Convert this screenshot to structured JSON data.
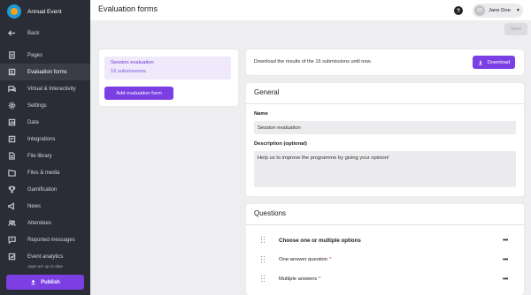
{
  "app": {
    "event_name": "Annual Event"
  },
  "sidebar": {
    "back": "Back",
    "items": [
      {
        "label": "Pages",
        "icon": "pages-icon"
      },
      {
        "label": "Evaluation forms",
        "icon": "evaluation-icon",
        "active": true
      },
      {
        "label": "Virtual & Interactivity",
        "icon": "chat-icon"
      },
      {
        "label": "Settings",
        "icon": "gear-icon"
      },
      {
        "label": "Data",
        "icon": "database-icon"
      },
      {
        "label": "Integrations",
        "icon": "integrations-icon"
      },
      {
        "label": "File library",
        "icon": "file-icon"
      },
      {
        "label": "Files & media",
        "icon": "media-icon"
      },
      {
        "label": "Gamification",
        "icon": "trophy-icon"
      },
      {
        "label": "News",
        "icon": "news-icon"
      },
      {
        "label": "Attendees",
        "icon": "people-icon"
      },
      {
        "label": "Reported messages",
        "icon": "report-icon"
      },
      {
        "label": "Event analytics",
        "icon": "analytics-icon"
      }
    ],
    "status": "Apps are up to date",
    "publish_label": "Publish"
  },
  "header": {
    "title": "Evaluation forms",
    "help_symbol": "?",
    "user_initials": "JD",
    "user_name": "Jane Doe",
    "save_label": "Save"
  },
  "forms_list": {
    "items": [
      {
        "name": "Session evaluation",
        "submissions": "16 submissions"
      }
    ],
    "add_label": "Add evaluation form"
  },
  "download": {
    "text": "Download the results of the 16 submissions until now.",
    "button_label": "Download"
  },
  "general": {
    "title": "General",
    "name_label": "Name",
    "name_value": "Session evaluation",
    "description_label": "Description (optional)",
    "description_value": "Help us to improve the programme by giving your opinion!"
  },
  "questions": {
    "title": "Questions",
    "items": [
      {
        "text": "Choose one or multiple options",
        "required": false
      },
      {
        "text": "One-answer question",
        "required": true
      },
      {
        "text": "Multiple answers",
        "required": true
      }
    ],
    "required_mark": "*",
    "more_symbol": "•••"
  }
}
